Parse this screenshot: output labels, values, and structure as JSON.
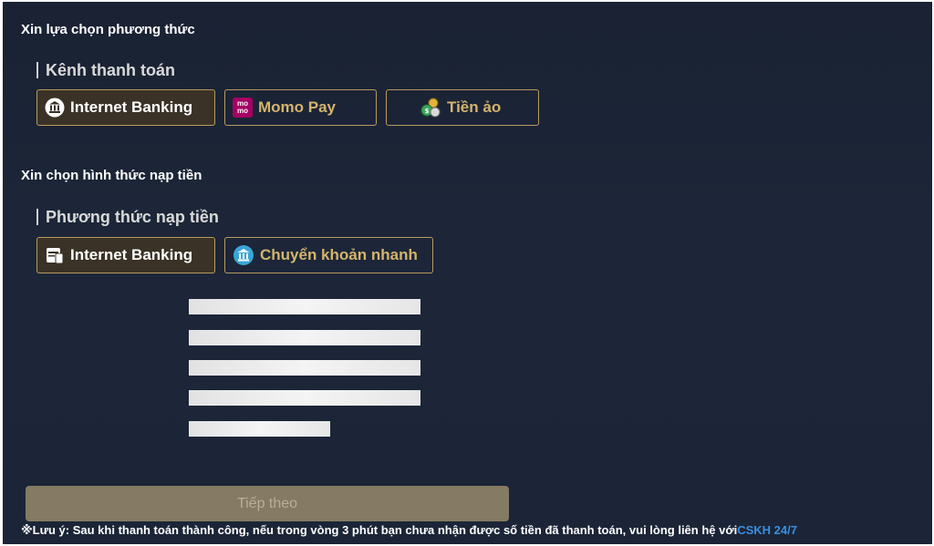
{
  "channel_section": {
    "title": "Xin lựa chọn phương thức",
    "group_label": "Kênh thanh toán",
    "options": [
      {
        "label": "Internet Banking",
        "icon": "bank-icon",
        "selected": true
      },
      {
        "label": "Momo Pay",
        "icon": "momo-icon",
        "icon_text_top": "mo",
        "icon_text_bottom": "mo",
        "selected": false
      },
      {
        "label": "Tiền ảo",
        "icon": "crypto-coins-icon",
        "selected": false
      }
    ]
  },
  "method_section": {
    "title": "Xin chọn hình thức nạp tiền",
    "group_label": "Phương thức nạp tiền",
    "options": [
      {
        "label": "Internet Banking",
        "icon": "card-icon",
        "selected": true
      },
      {
        "label": "Chuyển khoản nhanh",
        "icon": "bank-circle-icon",
        "selected": false
      }
    ]
  },
  "submit": {
    "label": "Tiếp theo",
    "disabled": true
  },
  "note": {
    "prefix": "※Lưu ý: Sau khi thanh toán thành công, nếu trong vòng 3 phút bạn chưa nhận được số tiền đã thanh toán, vui lòng liên hệ với",
    "link": "CSKH 24/7"
  },
  "colors": {
    "background": "#1b2537",
    "accent_gold": "#d4b46c",
    "border_gold": "#b99a5c",
    "selected_bg": "#3a3226",
    "submit_bg": "#857a63",
    "link_blue": "#3a8fe0"
  }
}
